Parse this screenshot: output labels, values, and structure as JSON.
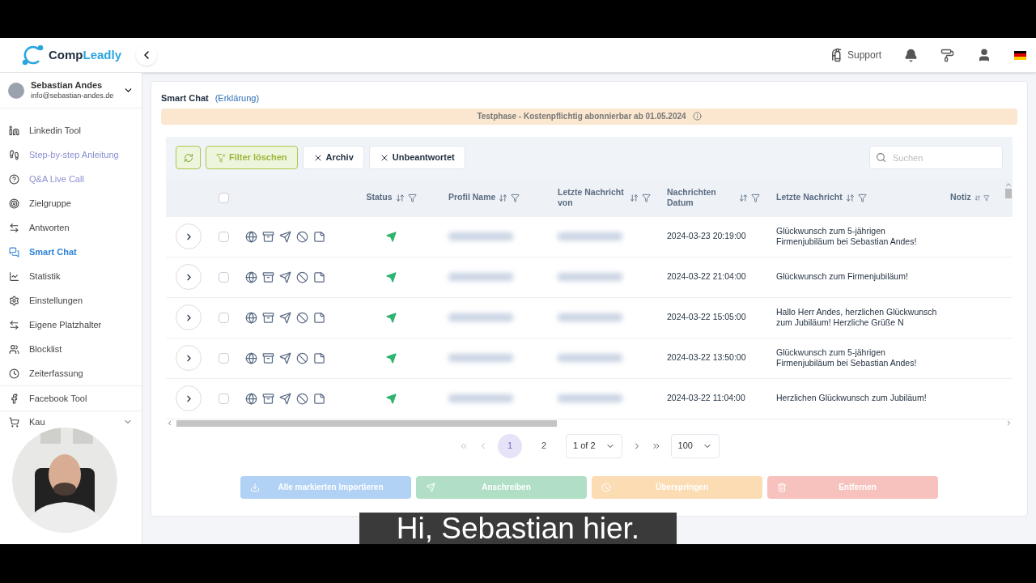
{
  "brand": {
    "name_a": "Comp",
    "name_b": "Leadly"
  },
  "user": {
    "name": "Sebastian Andes",
    "email": "info@sebastian-andes.de"
  },
  "nav_groups": [
    [
      {
        "label": "Linkedin Tool",
        "kind": "item",
        "selected": false
      },
      {
        "label": "Step-by-step Anleitung",
        "kind": "guide",
        "selected": false
      },
      {
        "label": "Q&A Live Call",
        "kind": "guide",
        "selected": false
      },
      {
        "label": "Zielgruppe",
        "kind": "item",
        "selected": false
      },
      {
        "label": "Antworten",
        "kind": "item",
        "selected": false
      },
      {
        "label": "Smart Chat",
        "kind": "item",
        "selected": true
      },
      {
        "label": "Statistik",
        "kind": "item",
        "selected": false
      },
      {
        "label": "Einstellungen",
        "kind": "item",
        "selected": false
      },
      {
        "label": "Eigene Platzhalter",
        "kind": "item",
        "selected": false
      },
      {
        "label": "Blocklist",
        "kind": "item",
        "selected": false
      },
      {
        "label": "Zeiterfassung",
        "kind": "item",
        "selected": false
      }
    ],
    [
      {
        "label": "Facebook Tool",
        "kind": "item",
        "selected": false
      }
    ],
    [
      {
        "label": "Kau",
        "kind": "menu",
        "selected": false
      }
    ]
  ],
  "header": {
    "support": "Support"
  },
  "page": {
    "title": "Smart Chat",
    "link": "(Erklärung)"
  },
  "banner": "Testphase - Kostenpflichtig abonnierbar ab 01.05.2024",
  "toolbar": [
    {
      "kind": "refresh"
    },
    {
      "kind": "clear",
      "label": "Filter löschen"
    },
    {
      "kind": "chip",
      "label": "Archiv"
    },
    {
      "kind": "chip",
      "label": "Unbeantwortet"
    }
  ],
  "search": {
    "placeholder": "Suchen"
  },
  "select_all": {
    "checked": false
  },
  "columns": [
    {
      "label": "Status"
    },
    {
      "label": "Profil Name"
    },
    {
      "label": "Letzte Nachricht von"
    },
    {
      "label": "Nachrichten Datum"
    },
    {
      "label": "Letzte Nachricht"
    },
    {
      "label": "Notiz"
    }
  ],
  "rows": [
    {
      "date": "2024-03-23 20:19:00",
      "message": "Glückwunsch zum 5-jährigen Firmenjubiläum bei Sebastian Andes!",
      "checked": false
    },
    {
      "date": "2024-03-22 21:04:00",
      "message": "Glückwunsch zum Firmenjubiläum!",
      "checked": false
    },
    {
      "date": "2024-03-22 15:05:00",
      "message": "Hallo Herr Andes, herzlichen Glückwunsch zum Jubiläum! Herzliche Grüße N",
      "checked": false
    },
    {
      "date": "2024-03-22 13:50:00",
      "message": "Glückwunsch zum 5-jährigen Firmenjubiläum bei Sebastian Andes!",
      "checked": false
    },
    {
      "date": "2024-03-22 11:04:00",
      "message": "Herzlichen Glückwunsch zum Jubiläum!",
      "checked": false
    }
  ],
  "pagination": {
    "pages": [
      {
        "label": "1",
        "selected": true
      },
      {
        "label": "2",
        "selected": false
      }
    ],
    "page_select": "1 of 2",
    "page_size": "100"
  },
  "actions": [
    {
      "kind": "import",
      "label": "Alle markierten Importieren",
      "disabled": true
    },
    {
      "kind": "write",
      "label": "Anschreiben",
      "disabled": true
    },
    {
      "kind": "skip",
      "label": "Überspringen",
      "disabled": true
    },
    {
      "kind": "remove",
      "label": "Entfernen",
      "disabled": true
    }
  ],
  "subtitle": "Hi, Sebastian hier."
}
